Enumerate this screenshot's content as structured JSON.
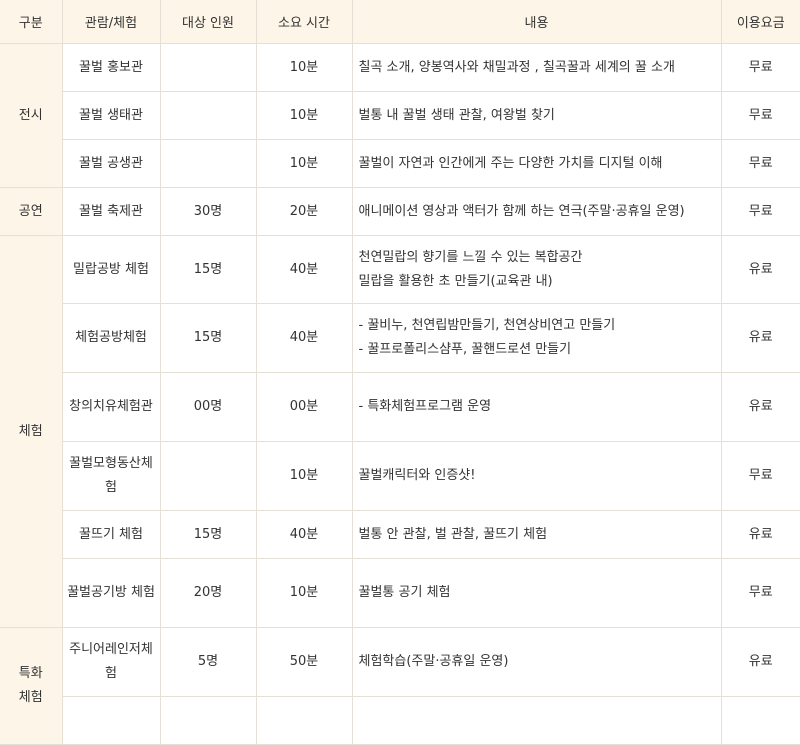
{
  "headers": [
    "구분",
    "관람/체험",
    "대상 인원",
    "소요 시간",
    "내용",
    "이용요금"
  ],
  "categories": {
    "exhibit": "전시",
    "performance": "공연",
    "experience": "체험",
    "special": "특화\n체험"
  },
  "rows": [
    {
      "facility": "꿀벌 홍보관",
      "people": "",
      "time": "10분",
      "content": [
        "칠곡 소개, 양봉역사와 채밀과정 , 칠곡꿀과 세계의 꿀 소개"
      ],
      "fee": "무료"
    },
    {
      "facility": "꿀벌 생태관",
      "people": "",
      "time": "10분",
      "content": [
        "벌통 내 꿀벌 생태 관찰, 여왕벌 찾기"
      ],
      "fee": "무료"
    },
    {
      "facility": "꿀벌 공생관",
      "people": "",
      "time": "10분",
      "content": [
        "꿀벌이 자연과 인간에게 주는 다양한 가치를 디지털 이해"
      ],
      "fee": "무료"
    },
    {
      "facility": "꿀벌 축제관",
      "people": "30명",
      "time": "20분",
      "content": [
        "애니메이션 영상과 액터가 함께 하는 연극(주말·공휴일 운영)"
      ],
      "fee": "무료"
    },
    {
      "facility": "밀랍공방 체험",
      "people": "15명",
      "time": "40분",
      "content": [
        "천연밀랍의 향기를 느낄 수 있는 복합공간",
        "밀랍을 활용한 초 만들기(교육관 내)"
      ],
      "fee": "유료"
    },
    {
      "facility": "체험공방체험",
      "people": "15명",
      "time": "40분",
      "content": [
        "- 꿀비누, 천연립밤만들기, 천연상비연고 만들기",
        "- 꿀프로폴리스샴푸, 꿀핸드로션 만들기"
      ],
      "fee": "유료"
    },
    {
      "facility": "창의치유체험관",
      "people": "00명",
      "time": "00분",
      "content": [
        "- 특화체험프로그램 운영"
      ],
      "fee": "유료"
    },
    {
      "facility": "꿀벌모형동산체험",
      "people": "",
      "time": "10분",
      "content": [
        "꿀벌캐릭터와 인증샷!"
      ],
      "fee": "무료"
    },
    {
      "facility": "꿀뜨기 체험",
      "people": "15명",
      "time": "40분",
      "content": [
        "벌통 안 관찰, 벌 관찰, 꿀뜨기 체험"
      ],
      "fee": "유료"
    },
    {
      "facility": "꿀벌공기방 체험",
      "people": "20명",
      "time": "10분",
      "content": [
        "꿀벌통 공기 체험"
      ],
      "fee": "무료"
    },
    {
      "facility": "주니어레인저체험",
      "people": "5명",
      "time": "50분",
      "content": [
        "체험학습(주말·공휴일 운영)"
      ],
      "fee": "유료"
    },
    {
      "facility": "",
      "people": "",
      "time": "",
      "content": [
        ""
      ],
      "fee": ""
    }
  ]
}
